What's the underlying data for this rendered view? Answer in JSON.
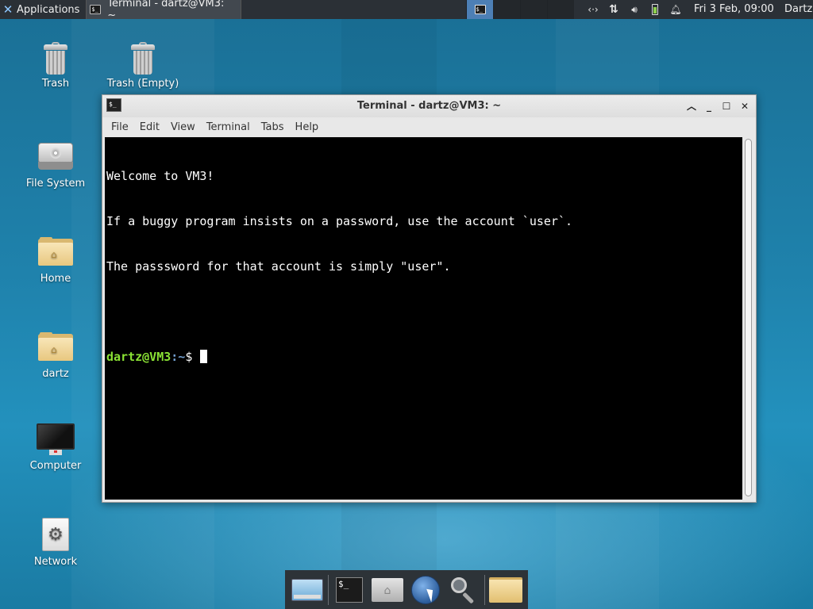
{
  "top_panel": {
    "applications_label": "Applications",
    "task_title": "Terminal - dartz@VM3: ~",
    "clock": "Fri  3 Feb, 09:00",
    "user": "Dartz",
    "tray_icons": [
      "network-arrows-icon",
      "transfer-icon",
      "volume-icon",
      "battery-icon",
      "notification-bell-icon"
    ]
  },
  "desktop": {
    "icons": [
      {
        "label": "Trash",
        "icon": "trash-icon"
      },
      {
        "label": "Trash (Empty)",
        "icon": "trash-icon"
      },
      {
        "label": "File System",
        "icon": "drive-icon"
      },
      {
        "label": "Home",
        "icon": "home-folder-icon"
      },
      {
        "label": "dartz",
        "icon": "home-folder-icon"
      },
      {
        "label": "Computer",
        "icon": "monitor-icon"
      },
      {
        "label": "Network",
        "icon": "network-gear-icon"
      }
    ]
  },
  "terminal": {
    "title": "Terminal - dartz@VM3: ~",
    "menu": [
      "File",
      "Edit",
      "View",
      "Terminal",
      "Tabs",
      "Help"
    ],
    "lines": [
      "Welcome to VM3!",
      "If a buggy program insists on a password, use the account `user`.",
      "The passsword for that account is simply \"user\".",
      ""
    ],
    "prompt_user": "dartz@VM3",
    "prompt_path": ":~",
    "prompt_symbol": "$ "
  },
  "dock": {
    "items": [
      "show-desktop-icon",
      "terminal-icon",
      "home-folder-icon",
      "web-browser-icon",
      "search-icon",
      "folder-icon"
    ]
  },
  "colors": {
    "prompt_user": "#8ae234",
    "prompt_path": "#729fcf",
    "panel_bg": "#2b3036",
    "desktop_accent": "#1f82ac"
  }
}
